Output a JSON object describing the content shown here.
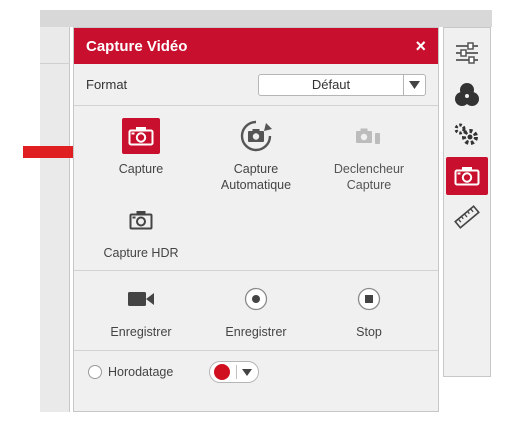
{
  "panel": {
    "title": "Capture Vidéo",
    "close_glyph": "×"
  },
  "format": {
    "label": "Format",
    "selected": "Défaut"
  },
  "tools": [
    {
      "label_line1": "Capture",
      "label_line2": "",
      "icon": "camera-icon",
      "active": true
    },
    {
      "label_line1": "Capture",
      "label_line2": "Automatique",
      "icon": "auto-capture-icon",
      "active": false
    },
    {
      "label_line1": "Declencheur",
      "label_line2": "Capture",
      "icon": "trigger-capture-icon",
      "active": false,
      "disabled": true
    },
    {
      "label_line1": "Capture HDR",
      "label_line2": "",
      "icon": "hdr-camera-icon",
      "active": false
    }
  ],
  "recording": [
    {
      "label": "Enregistrer",
      "icon": "video-camera-icon"
    },
    {
      "label": "Enregistrer",
      "icon": "record-icon"
    },
    {
      "label": "Stop",
      "icon": "stop-icon"
    }
  ],
  "timestamp": {
    "label": "Horodatage",
    "color": "#d0101e"
  },
  "sidebar": [
    {
      "icon": "sliders-icon",
      "active": false
    },
    {
      "icon": "color-circles-icon",
      "active": false
    },
    {
      "icon": "gears-icon",
      "active": false
    },
    {
      "icon": "camera-icon",
      "active": true
    },
    {
      "icon": "ruler-icon",
      "active": false
    }
  ],
  "colors": {
    "accent": "#c8102e",
    "pointer_arrow": "#e02020"
  }
}
